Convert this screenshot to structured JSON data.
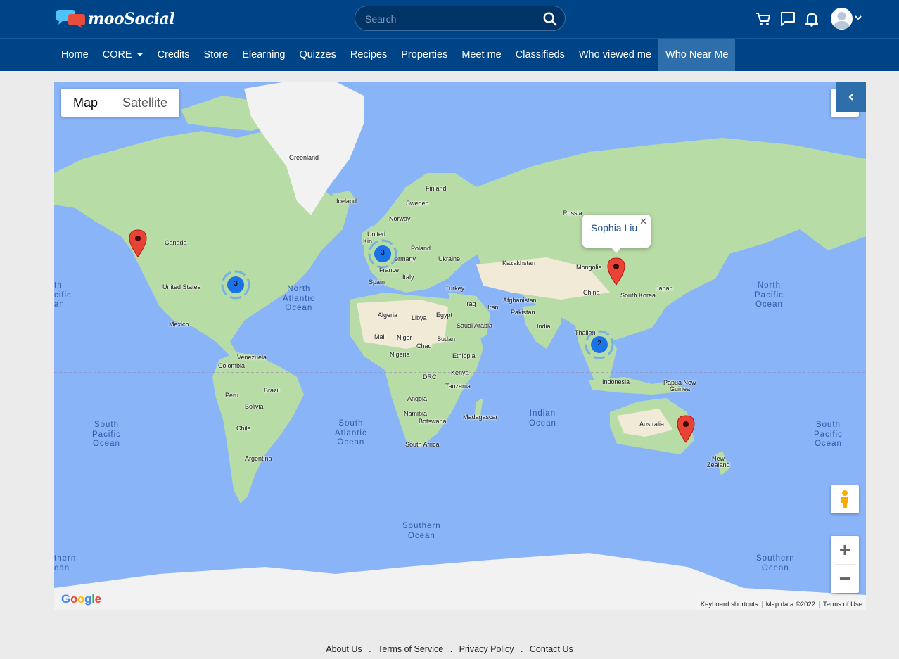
{
  "brand": {
    "name": "mooSocial"
  },
  "search": {
    "placeholder": "Search"
  },
  "header_icons": [
    "cart-icon",
    "chat-icon",
    "bell-icon",
    "user-avatar"
  ],
  "nav": {
    "items": [
      {
        "label": "Home"
      },
      {
        "label": "CORE",
        "dropdown": true
      },
      {
        "label": "Credits"
      },
      {
        "label": "Store"
      },
      {
        "label": "Elearning"
      },
      {
        "label": "Quizzes"
      },
      {
        "label": "Recipes"
      },
      {
        "label": "Properties"
      },
      {
        "label": "Meet me"
      },
      {
        "label": "Classifieds"
      },
      {
        "label": "Who viewed me"
      },
      {
        "label": "Who Near Me",
        "active": true
      }
    ]
  },
  "map": {
    "type_buttons": {
      "map": "Map",
      "satellite": "Satellite"
    },
    "infowindow": {
      "name": "Sophia Liu"
    },
    "clusters": [
      {
        "id": "europe",
        "count": "3"
      },
      {
        "id": "us-east",
        "count": "3"
      },
      {
        "id": "se-asia",
        "count": "2"
      }
    ],
    "labels": {
      "greenland": "Greenland",
      "iceland": "Iceland",
      "finland": "Finland",
      "sweden": "Sweden",
      "norway": "Norway",
      "russia": "Russia",
      "united": "United",
      "kingdom": "Kin",
      "poland": "Poland",
      "germany": "ermany",
      "ukraine": "Ukraine",
      "france": "France",
      "spain": "Spain",
      "italy": "Italy",
      "turkey": "Turkey",
      "kazakhstan": "Kazakhstan",
      "mongolia": "Mongolia",
      "china": "China",
      "japan": "Japan",
      "south_korea": "South Korea",
      "canada": "Canada",
      "united_states": "United States",
      "mexico": "Mexico",
      "iraq": "Iraq",
      "iran": "Iran",
      "afghanistan": "Afghanistan",
      "pakistan": "Pakistan",
      "india": "India",
      "thailand": "Thailan",
      "algeria": "Algeria",
      "libya": "Libya",
      "egypt": "Egypt",
      "saudi_arabia": "Saudi Arabia",
      "mali": "Mali",
      "niger": "Niger",
      "chad": "Chad",
      "sudan": "Sudan",
      "nigeria": "Nigeria",
      "ethiopia": "Ethiopia",
      "kenya": "Kenya",
      "drc": "DRC",
      "tanzania": "Tanzania",
      "angola": "Angola",
      "namibia": "Namibia",
      "botswana": "Botswana",
      "madagascar": "Madagascar",
      "south_africa": "South Africa",
      "venezuela": "Venezuela",
      "colombia": "Colombia",
      "brazil": "Brazil",
      "peru": "Peru",
      "bolivia": "Bolivia",
      "chile": "Chile",
      "argentina": "Argentina",
      "indonesia": "Indonesia",
      "papua": "Papua New",
      "guinea": "Guinea",
      "australia": "Australia",
      "new": "New",
      "zealand": "Zealand"
    },
    "oceans": {
      "north_atlantic": [
        "North",
        "Atlantic",
        "Ocean"
      ],
      "south_atlantic": [
        "South",
        "Atlantic",
        "Ocean"
      ],
      "indian": [
        "Indian",
        "Ocean"
      ],
      "north_pacific_right": [
        "North",
        "Pacific",
        "Ocean"
      ],
      "north_pacific_left": [
        "th",
        "cific",
        "an"
      ],
      "south_pacific_left": [
        "South",
        "Pacific",
        "Ocean"
      ],
      "south_pacific_right": [
        "South",
        "Pacific",
        "Ocean"
      ],
      "southern_center": [
        "Southern",
        "Ocean"
      ],
      "southern_right": [
        "Southern",
        "Ocean"
      ],
      "southern_left": [
        "thern",
        "ean"
      ]
    },
    "google_logo": "Google",
    "attribution": {
      "shortcuts": "Keyboard shortcuts",
      "data": "Map data ©2022",
      "terms": "Terms of Use"
    }
  },
  "footer": {
    "links": [
      "About Us",
      "Terms of Service",
      "Privacy Policy",
      "Contact Us"
    ],
    "separator": "."
  },
  "colors": {
    "header": "#004488",
    "nav_active": "#2d6eab",
    "water": "#8ab4f8",
    "land": "#b8dca6",
    "pin": "#ea4335",
    "cluster": "#1a73e8"
  }
}
